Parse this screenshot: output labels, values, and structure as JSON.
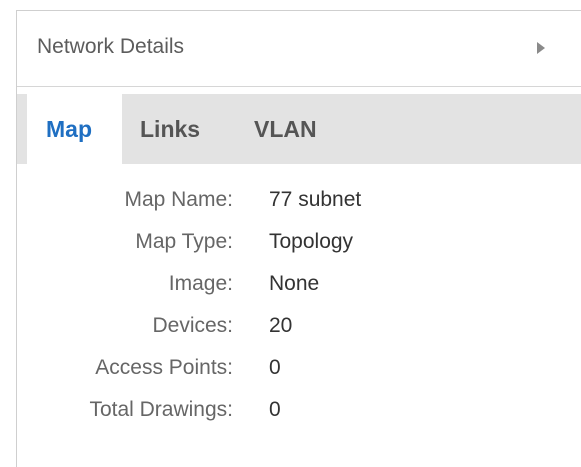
{
  "panel": {
    "title": "Network Details"
  },
  "tabs": [
    {
      "label": "Map",
      "active": true
    },
    {
      "label": "Links",
      "active": false
    },
    {
      "label": "VLAN",
      "active": false
    }
  ],
  "details": [
    {
      "label": "Map Name:",
      "value": "77 subnet"
    },
    {
      "label": "Map Type:",
      "value": "Topology"
    },
    {
      "label": "Image:",
      "value": "None"
    },
    {
      "label": "Devices:",
      "value": "20"
    },
    {
      "label": "Access Points:",
      "value": "0"
    },
    {
      "label": "Total Drawings:",
      "value": "0"
    }
  ],
  "icons": {
    "expand": "caret-right-icon"
  },
  "colors": {
    "active_tab_text": "#1f6fc2",
    "tab_bar_bg": "#e3e3e3",
    "label_text": "#666666",
    "value_text": "#333333"
  }
}
